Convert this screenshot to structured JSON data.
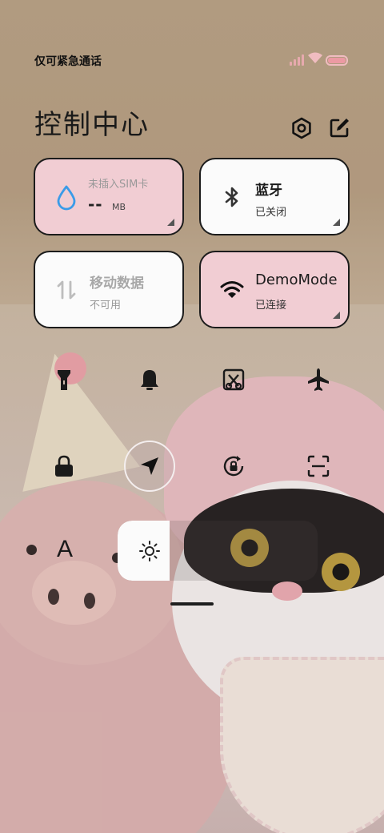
{
  "status_bar": {
    "carrier_text": "仅可紧急通话",
    "icons": [
      "cellular-signal-icon",
      "wifi-icon",
      "battery-icon"
    ],
    "accent_color": "#f0bcc0"
  },
  "header": {
    "title": "控制中心",
    "actions": [
      "settings-icon",
      "edit-icon"
    ]
  },
  "tiles": {
    "data_usage": {
      "label": "未插入SIM卡",
      "value": "--",
      "unit": "MB",
      "icon": "water-drop-icon",
      "state": "active"
    },
    "bluetooth": {
      "label": "蓝牙",
      "status": "已关闭",
      "icon": "bluetooth-icon",
      "state": "off"
    },
    "mobile_data": {
      "label": "移动数据",
      "status": "不可用",
      "icon": "data-transfer-icon",
      "state": "disabled"
    },
    "wifi": {
      "label": "DemoMode",
      "status": "已连接",
      "icon": "wifi-icon",
      "state": "on"
    }
  },
  "toggles": [
    {
      "name": "flashlight",
      "icon": "flashlight-icon",
      "active": false
    },
    {
      "name": "silent",
      "icon": "bell-icon",
      "active": false
    },
    {
      "name": "screenshot",
      "icon": "scissors-icon",
      "active": false
    },
    {
      "name": "airplane-mode",
      "icon": "airplane-icon",
      "active": false
    },
    {
      "name": "lock-screen",
      "icon": "lock-icon",
      "active": false
    },
    {
      "name": "location",
      "icon": "location-arrow-icon",
      "active": true
    },
    {
      "name": "rotation-lock",
      "icon": "rotation-lock-icon",
      "active": false
    },
    {
      "name": "scanner",
      "icon": "scan-icon",
      "active": false
    }
  ],
  "brightness": {
    "auto_label": "A",
    "level": 0.26,
    "icon": "sun-icon"
  },
  "colors": {
    "tile_pink": "#f1cdd3",
    "tile_white": "#fbfbfb",
    "wifi_blue": "#3a9be8"
  }
}
